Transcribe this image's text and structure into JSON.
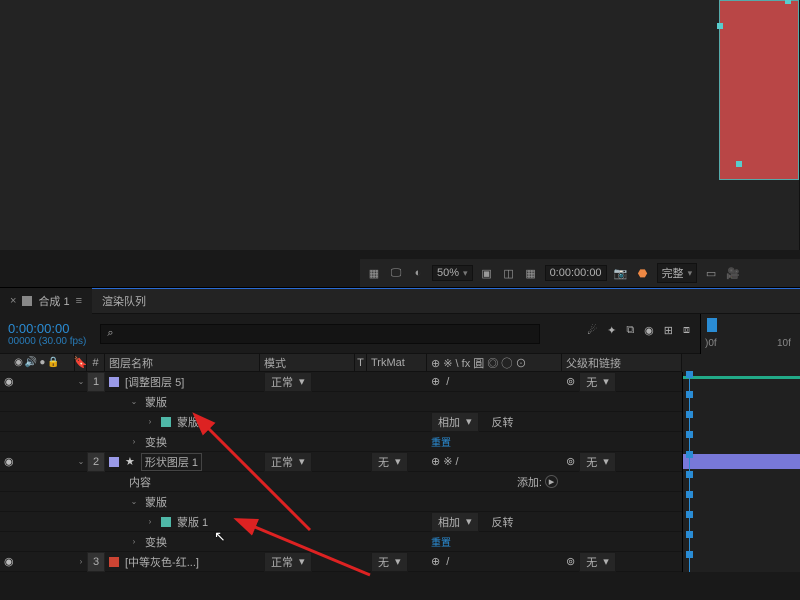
{
  "preview": {
    "zoom": "50%",
    "timecode": "0:00:00:00",
    "res": "完整"
  },
  "tabs": {
    "comp": "合成 1",
    "render": "渲染队列"
  },
  "timeHead": {
    "tc": "0:00:00:00",
    "fps": "00000 (30.00 fps)",
    "searchIcon": "⌕",
    "rulerStart": ")0f",
    "rulerTick": "10f"
  },
  "columns": {
    "num": "#",
    "name": "图层名称",
    "mode": "模式",
    "t": "T",
    "trk": "TrkMat",
    "parent": "父级和链接"
  },
  "switchIcons": "⊕ ※ \\ fx 圓 ◎ ◯ ⊙",
  "layers": [
    {
      "idx": "1",
      "color": "c-lav",
      "name": "[调整图层 5]",
      "mode": "正常",
      "trk": "",
      "parent": "无",
      "bar": "green"
    },
    {
      "idx": "2",
      "color": "c-lav",
      "name": "形状图层 1",
      "mode": "正常",
      "trk": "无",
      "parent": "无",
      "bar": "lav",
      "star": true,
      "boxed": true
    },
    {
      "idx": "3",
      "color": "c-red",
      "name": "[中等灰色-红...]",
      "mode": "正常",
      "trk": "无",
      "parent": "无"
    }
  ],
  "sub": {
    "masks": "蒙版",
    "mask1": "蒙版 1",
    "transform": "变换",
    "contents": "内容",
    "add": "相加",
    "invert": "反转",
    "reset": "重置",
    "addBtn": "添加:"
  },
  "dd": {
    "none": "无",
    "spiral": "@"
  }
}
